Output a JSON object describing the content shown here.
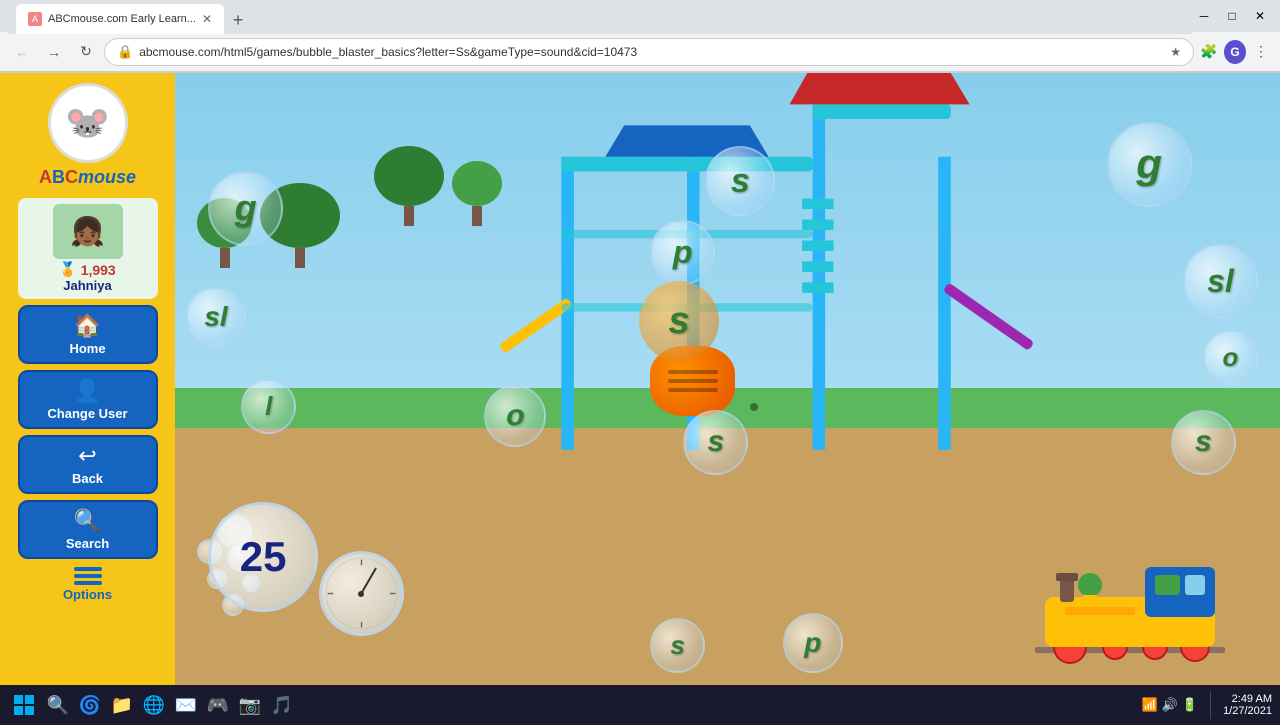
{
  "browser": {
    "tab_label": "ABCmouse.com Early Learn...",
    "url": "abcmouse.com/html5/games/bubble_blaster_basics?letter=Ss&gameType=sound&cid=10473",
    "back_title": "Back",
    "forward_title": "Forward",
    "refresh_title": "Refresh",
    "home_title": "Home"
  },
  "sidebar": {
    "logo": "ABCmouse",
    "logo_a": "A",
    "logo_b": "B",
    "logo_c": "C",
    "username": "Jahniya",
    "points": "1,993",
    "home_label": "Home",
    "change_user_label": "Change User",
    "back_label": "Back",
    "search_label": "Search",
    "options_label": "Options"
  },
  "game": {
    "score": "25",
    "letters": [
      "g",
      "s",
      "p",
      "l",
      "o",
      "s",
      "s",
      "sl",
      "g",
      "o",
      "s",
      "p",
      "s"
    ],
    "bubble_colors": [
      "transparent",
      "transparent",
      "transparent",
      "transparent",
      "transparent",
      "transparent",
      "orange",
      "transparent",
      "transparent",
      "transparent",
      "transparent",
      "transparent",
      "transparent"
    ]
  },
  "taskbar": {
    "time": "2:49 AM",
    "date": "1/27/2021",
    "start_icon": "⊞"
  }
}
